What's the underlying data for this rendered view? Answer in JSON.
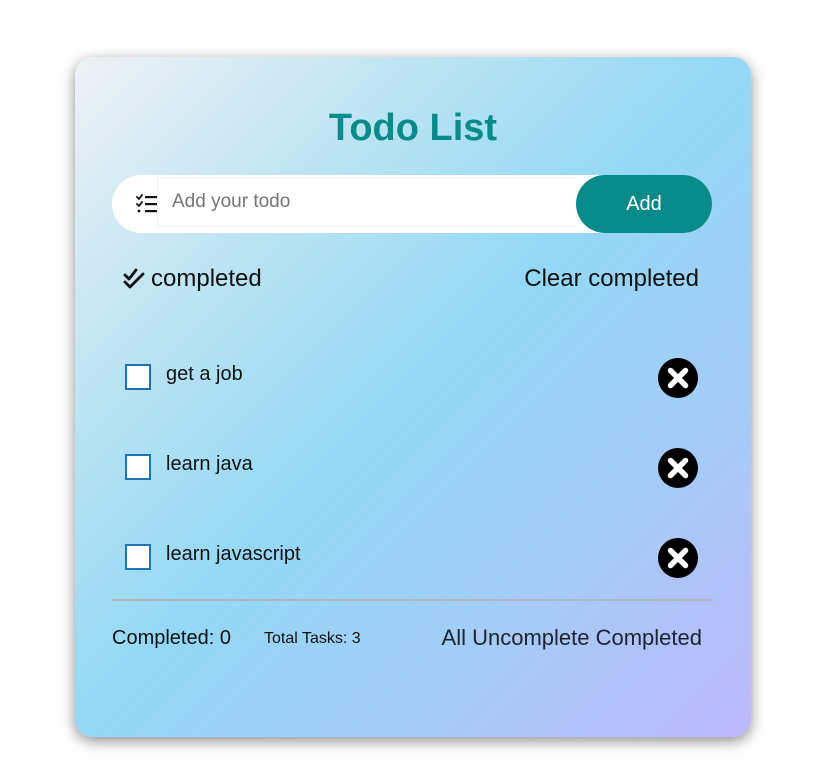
{
  "header": {
    "title": "Todo List"
  },
  "input": {
    "placeholder": "Add your todo",
    "value": "",
    "icon": "checklist-icon",
    "add_label": "Add"
  },
  "filters": {
    "completed_label": "completed",
    "completed_icon": "double-check-icon",
    "clear_completed_label": "Clear completed"
  },
  "todos": [
    {
      "text": "get a job",
      "checked": false
    },
    {
      "text": "learn java",
      "checked": false
    },
    {
      "text": "learn javascript",
      "checked": false
    }
  ],
  "footer": {
    "completed_text": "Completed: 0",
    "total_text": "Total Tasks: 3",
    "complete_all_label": "All Uncomplete Completed"
  },
  "colors": {
    "accent": "#0a8b8b",
    "checkbox_border": "#1d73b4",
    "gradient_start": "#eef2f4",
    "gradient_mid": "#93d8f5",
    "gradient_end": "#bdb8fd"
  }
}
